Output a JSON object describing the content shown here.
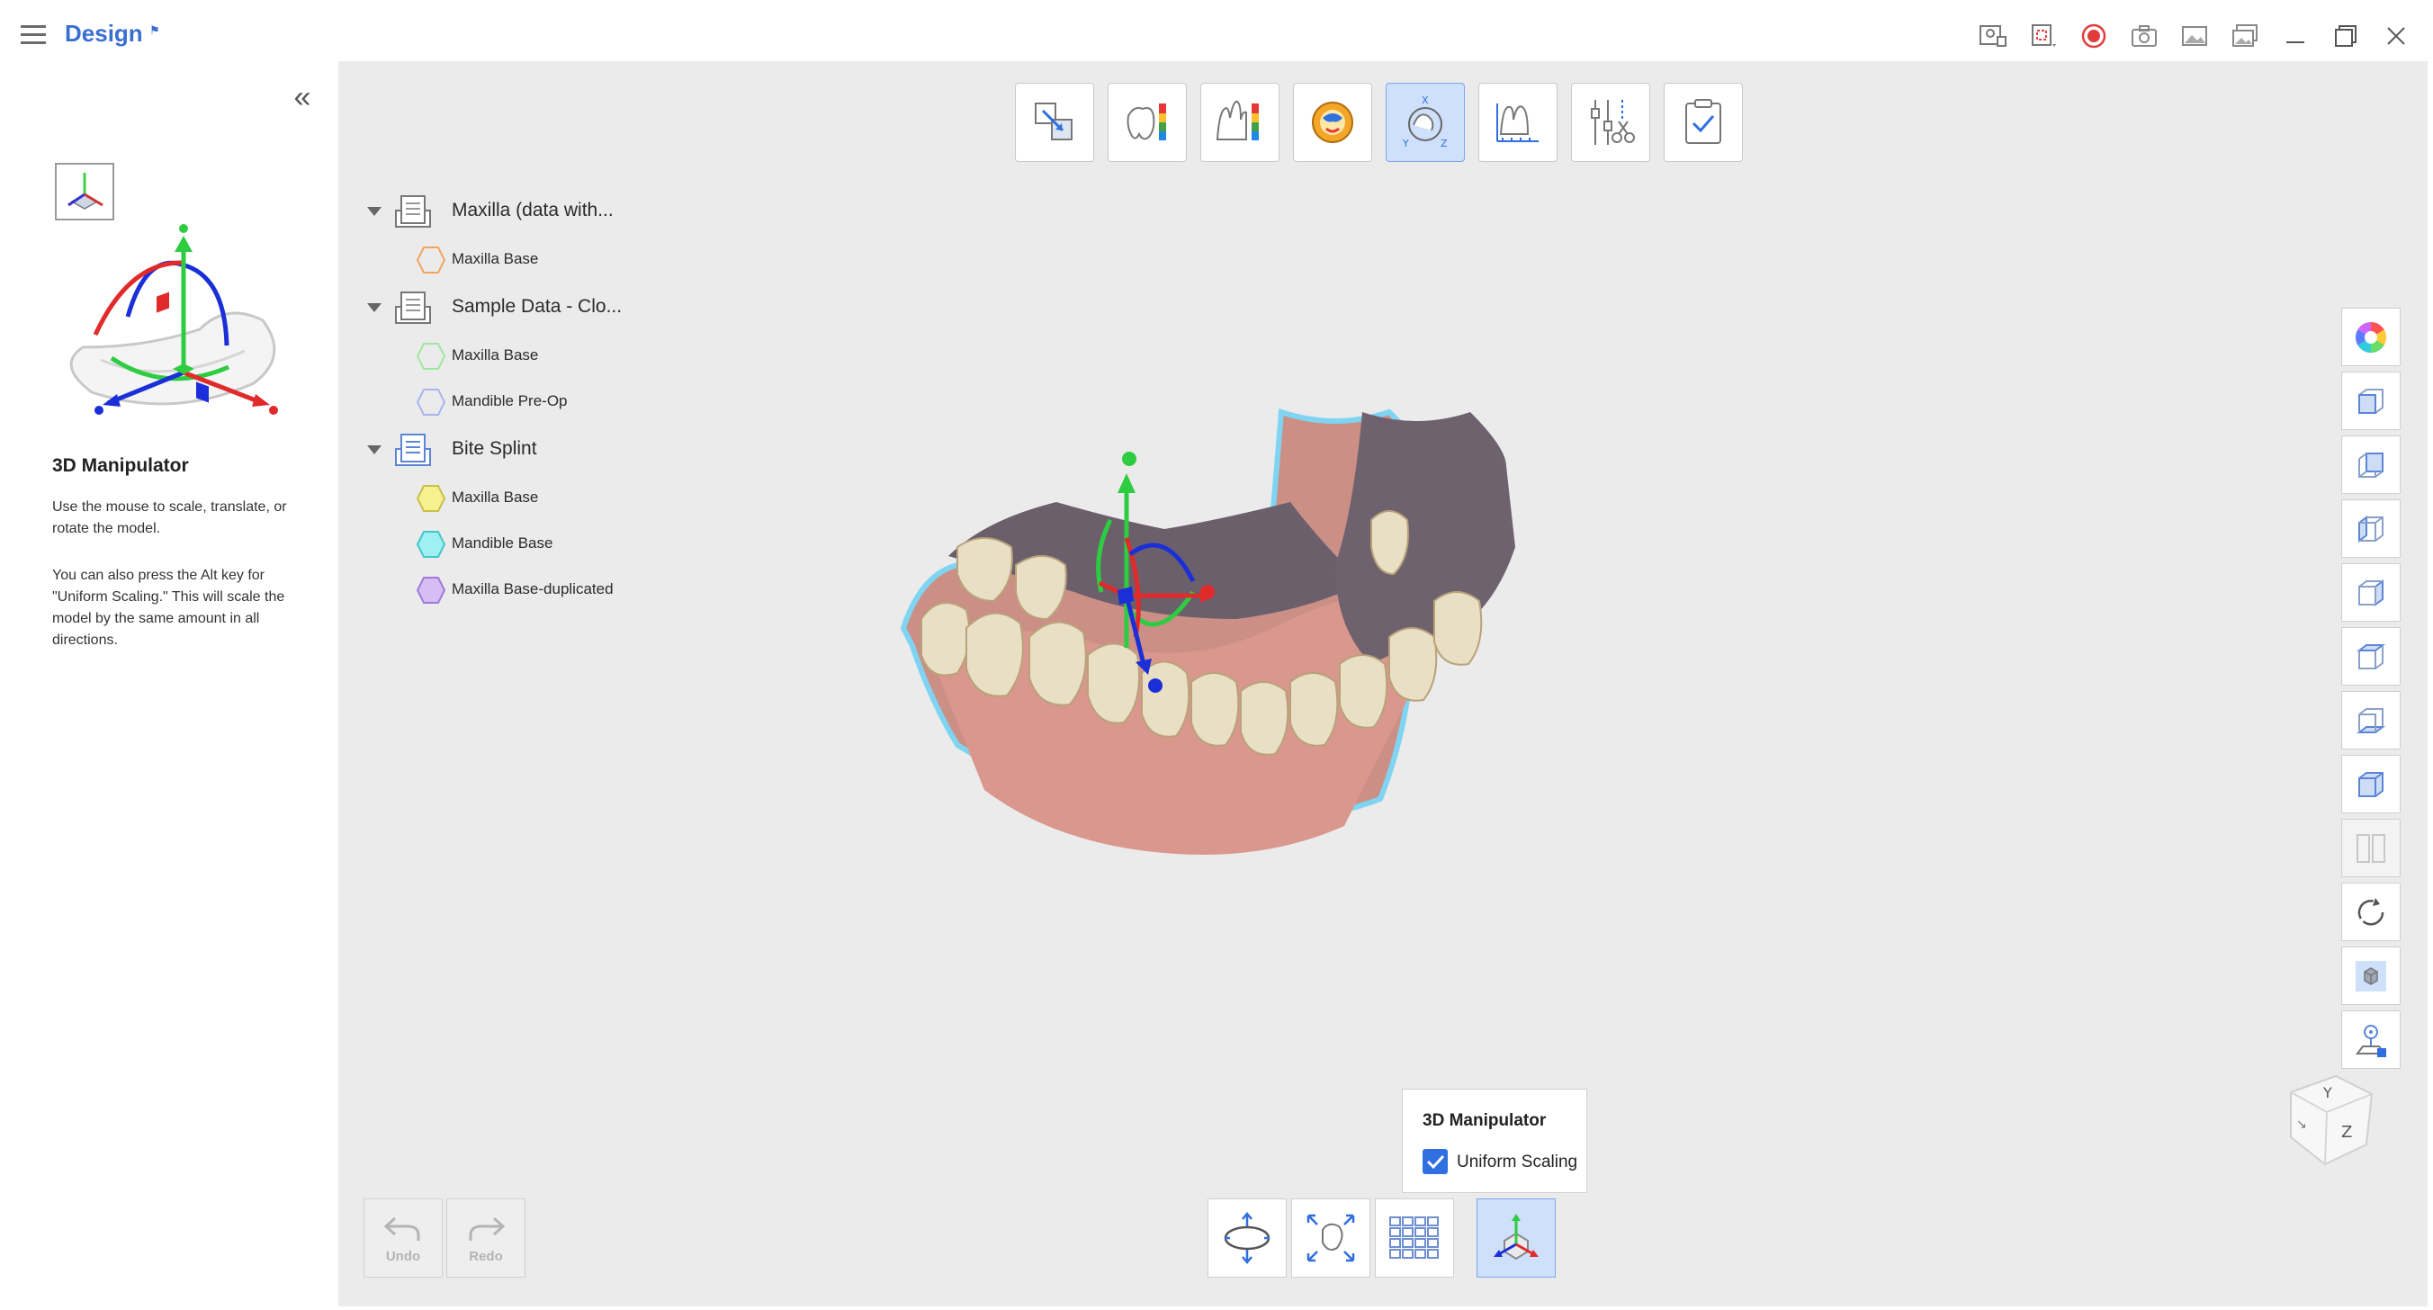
{
  "titlebar": {
    "app_title": "Design",
    "title_flag": "⚑",
    "window_icons": [
      "screen-capture-icon",
      "crop-capture-icon",
      "record-icon",
      "camera-icon",
      "image-icon",
      "gallery-icon",
      "minimize-icon",
      "restore-icon",
      "close-icon"
    ]
  },
  "help": {
    "title": "3D Manipulator",
    "paragraph1": "Use the mouse to scale, translate, or rotate the model.",
    "paragraph2": "You can also press the Alt key for \"Uniform Scaling.\" This will scale the model by the same amount in all directions."
  },
  "top_toolbar": {
    "tools": [
      {
        "name": "move-tool",
        "active": false
      },
      {
        "name": "deviation-map-tool",
        "active": false
      },
      {
        "name": "section-deviation-tool",
        "active": false
      },
      {
        "name": "occlusion-tool",
        "active": false
      },
      {
        "name": "3d-manipulator-tool",
        "active": true
      },
      {
        "name": "measure-tool",
        "active": false
      },
      {
        "name": "trim-tool",
        "active": false
      },
      {
        "name": "finish-tool",
        "active": false
      }
    ]
  },
  "tree": {
    "groups": [
      {
        "label": "Maxilla (data with...",
        "children": [
          {
            "label": "Maxilla Base",
            "color": "#f4a460"
          }
        ]
      },
      {
        "label": "Sample Data - Clo...",
        "children": [
          {
            "label": "Maxilla Base",
            "color": "#9ee89e"
          },
          {
            "label": "Mandible Pre-Op",
            "color": "#a9b4f0"
          }
        ]
      },
      {
        "label": "Bite Splint",
        "children": [
          {
            "label": "Maxilla Base",
            "color": "#f3ec7a"
          },
          {
            "label": "Mandible Base",
            "color": "#7fe6ea"
          },
          {
            "label": "Maxilla Base-duplicated",
            "color": "#c6a4ef"
          }
        ]
      }
    ]
  },
  "manipulator_popup": {
    "title": "3D Manipulator",
    "uniform_scaling_label": "Uniform Scaling",
    "uniform_scaling_checked": true
  },
  "undo_redo": {
    "undo_label": "Undo",
    "redo_label": "Redo"
  },
  "nav_cube": {
    "label_y": "Y",
    "label_z": "Z"
  },
  "colors": {
    "accent": "#3a6fd2",
    "active_bg": "#cfe0fb",
    "viewport_bg": "#ebebeb"
  }
}
